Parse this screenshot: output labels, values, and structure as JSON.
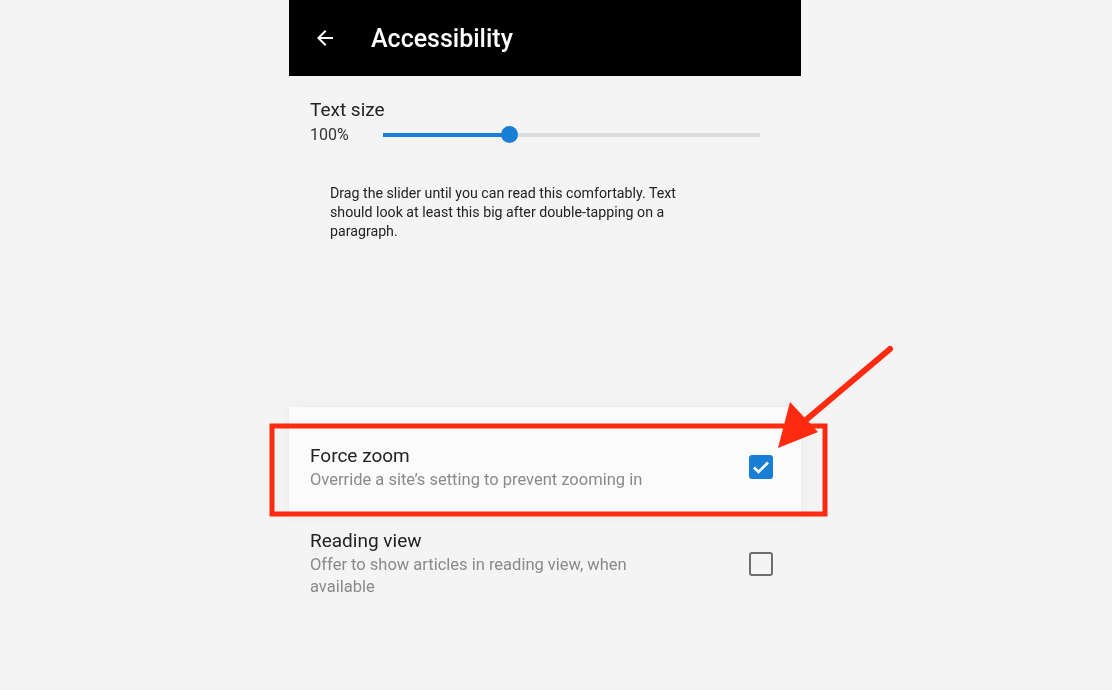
{
  "header": {
    "title": "Accessibility"
  },
  "text_size": {
    "label": "Text size",
    "reading": "100%",
    "level": 0.333,
    "description": "Drag the slider until you can read this comfortably. Text should look at least this big after double-tapping on a paragraph."
  },
  "settings": [
    {
      "title": "Force zoom",
      "subtitle": "Override a site’s setting to prevent zooming in",
      "checked": true,
      "highlighted": true
    },
    {
      "title": "Reading view",
      "subtitle": "Offer to show articles in reading view, when available",
      "checked": false,
      "highlighted": false
    }
  ]
}
